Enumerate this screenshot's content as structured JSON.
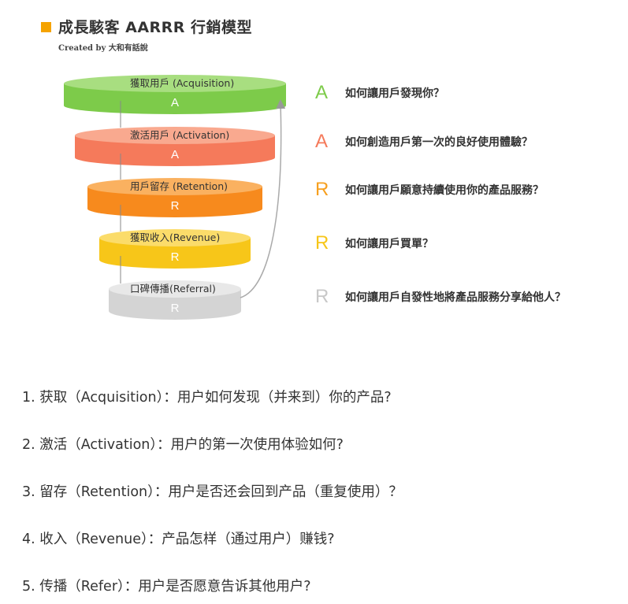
{
  "figure": {
    "title": "成長駭客 AARRR 行銷模型",
    "credit": "Created by 大和有話說",
    "title_marker_color": "#f5a300",
    "funnel": [
      {
        "stage": "獲取用戶 (Acquisition)",
        "letter": "A",
        "color": "#7dcb4a",
        "rim": "#a8de80",
        "question_letter_color": "#7dcb4a",
        "question": "如何讓用戶發現你？"
      },
      {
        "stage": "激活用戶 (Activation)",
        "letter": "A",
        "color": "#f57a5b",
        "rim": "#f9a98f",
        "question_letter_color": "#f57a5b",
        "question": "如何創造用戶第一次的良好使用體驗？"
      },
      {
        "stage": "用戶留存 (Retention)",
        "letter": "R",
        "color": "#f78a1d",
        "rim": "#fab160",
        "question_letter_color": "#f7a020",
        "question": "如何讓用戶願意持續使用你的產品服務？"
      },
      {
        "stage": "獲取收入(Revenue)",
        "letter": "R",
        "color": "#f7c619",
        "rim": "#fbdc6a",
        "question_letter_color": "#f7c619",
        "question": "如何讓用戶買單？"
      },
      {
        "stage": "口碑傳播(Referral)",
        "letter": "R",
        "color": "#d4d4d4",
        "rim": "#e8e8e8",
        "question_letter_color": "#c8c8c8",
        "question": "如何讓用戶自發性地將產品服務分享給他人？"
      }
    ]
  },
  "steps": [
    "1. 获取（Acquisition）：用户如何发现（并来到）你的产品?",
    "2. 激活（Activation）：用户的第一次使用体验如何?",
    "3. 留存（Retention）：用户是否还会回到产品（重复使用）？",
    "4. 收入（Revenue）：产品怎样（通过用户）赚钱?",
    "5. 传播（Refer）：用户是否愿意告诉其他用户?"
  ]
}
